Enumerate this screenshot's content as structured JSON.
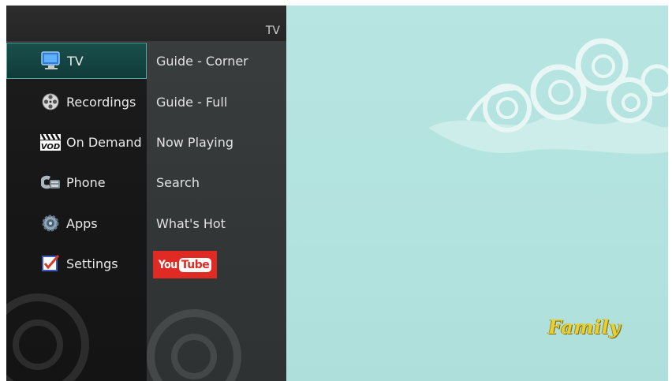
{
  "header": {
    "title": "TV"
  },
  "menu": {
    "items": [
      {
        "label": "TV",
        "icon": "tv-monitor-icon",
        "active": true
      },
      {
        "label": "Recordings",
        "icon": "film-reel-icon",
        "active": false
      },
      {
        "label": "On Demand",
        "icon": "vod-clapper-icon",
        "active": false
      },
      {
        "label": "Phone",
        "icon": "telephone-icon",
        "active": false
      },
      {
        "label": "Apps",
        "icon": "gear-icon",
        "active": false
      },
      {
        "label": "Settings",
        "icon": "checkbox-settings-icon",
        "active": false
      }
    ]
  },
  "submenu": {
    "items": [
      {
        "label": "Guide - Corner"
      },
      {
        "label": "Guide - Full"
      },
      {
        "label": "Now Playing"
      },
      {
        "label": "Search"
      },
      {
        "label": "What's Hot"
      }
    ],
    "youtube": {
      "you": "You",
      "tube": "Tube"
    }
  },
  "video": {
    "channel_logo": "Family"
  },
  "colors": {
    "accent": "#5aa7a2",
    "active_bg": "#134543",
    "youtube_red": "#e02b25",
    "video_bg": "#b7e5e1"
  }
}
